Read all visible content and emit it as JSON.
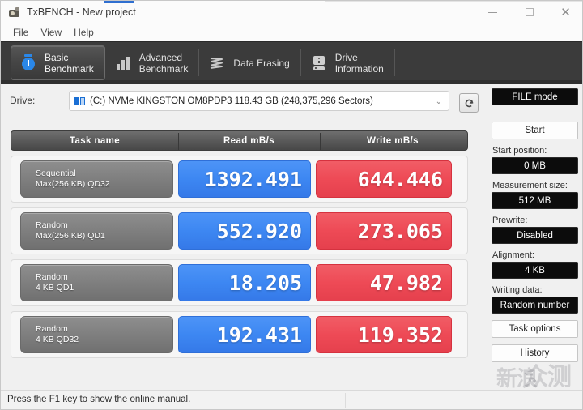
{
  "window": {
    "title": "TxBENCH - New project",
    "app_icon": "camera-icon",
    "minimize": "minimize-icon",
    "maximize": "maximize-icon",
    "close": "close-icon"
  },
  "menu": {
    "items": [
      "File",
      "View",
      "Help"
    ]
  },
  "tabs": [
    {
      "label": "Basic\nBenchmark",
      "icon": "stopwatch-icon",
      "active": true
    },
    {
      "label": "Advanced\nBenchmark",
      "icon": "bar-chart-icon",
      "active": false
    },
    {
      "label": "Data Erasing",
      "icon": "erase-icon",
      "active": false
    },
    {
      "label": "Drive\nInformation",
      "icon": "hard-drive-icon",
      "active": false
    }
  ],
  "drive": {
    "label": "Drive:",
    "value": "(C:) NVMe KINGSTON OM8PDP3  118.43 GB (248,375,296 Sectors)",
    "caret": "⌄",
    "refresh_icon": "refresh-icon"
  },
  "table": {
    "headers": [
      "Task name",
      "Read mB/s",
      "Write mB/s"
    ],
    "rows": [
      {
        "task_line1": "Sequential",
        "task_line2": "Max(256 KB) QD32",
        "read": "1392.491",
        "write": "644.446"
      },
      {
        "task_line1": "Random",
        "task_line2": "Max(256 KB) QD1",
        "read": "552.920",
        "write": "273.065"
      },
      {
        "task_line1": "Random",
        "task_line2": "4 KB QD1",
        "read": "18.205",
        "write": "47.982"
      },
      {
        "task_line1": "Random",
        "task_line2": "4 KB QD32",
        "read": "192.431",
        "write": "119.352"
      }
    ]
  },
  "panel": {
    "mode_button": "FILE mode",
    "start_button": "Start",
    "start_position_label": "Start position:",
    "start_position_value": "0 MB",
    "measurement_size_label": "Measurement size:",
    "measurement_size_value": "512 MB",
    "prewrite_label": "Prewrite:",
    "prewrite_value": "Disabled",
    "alignment_label": "Alignment:",
    "alignment_value": "4 KB",
    "writing_data_label": "Writing data:",
    "writing_data_value": "Random number",
    "task_options_button": "Task options",
    "history_button": "History"
  },
  "statusbar": {
    "message": "Press the F1 key to show the online manual."
  },
  "watermark": {
    "part1": "新浪",
    "part2": "众测"
  },
  "colors": {
    "read_blue": "#3d87f2",
    "write_red": "#ee4a56",
    "tabstrip_dark": "#3b3b3b",
    "task_gray": "#7f7f7f"
  }
}
